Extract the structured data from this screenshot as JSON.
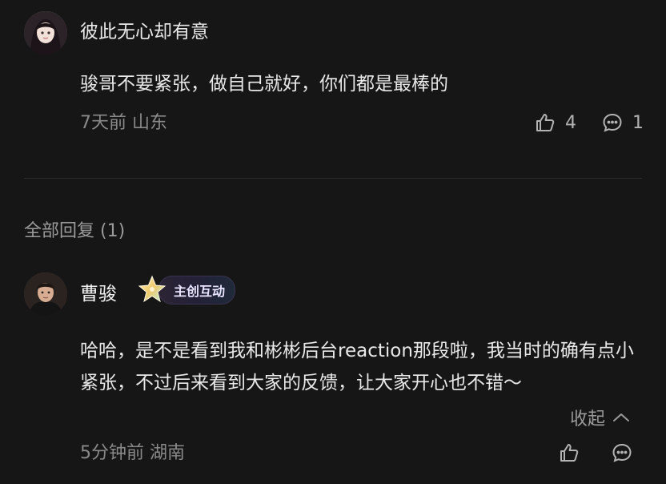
{
  "top_comment": {
    "username": "彼此无心却有意",
    "text": "骏哥不要紧张，做自己就好，你们都是最棒的",
    "meta": "7天前 山东",
    "like_count": "4",
    "reply_count": "1"
  },
  "replies_section": {
    "header": "全部回复 (1)"
  },
  "reply": {
    "username": "曹骏",
    "badge_label": "主创互动",
    "text": "哈哈，是不是看到我和彬彬后台reaction那段啦，我当时的确有点小紧张，不过后来看到大家的反馈，让大家开心也不错～",
    "collapse_label": "收起",
    "meta": "5分钟前 湖南"
  },
  "colors": {
    "background": "#161616",
    "text_primary": "#e9e9e9",
    "text_secondary": "#8a8a8a",
    "divider": "#2c2c2c"
  },
  "icons": {
    "like": "thumbs-up-icon",
    "reply": "comment-bubble-icon",
    "collapse": "chevron-up-icon",
    "badge": "star-badge-icon"
  }
}
